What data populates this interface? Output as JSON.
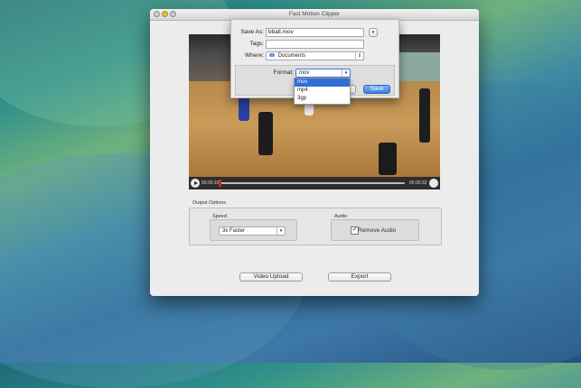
{
  "window": {
    "title": "Fast Motion Clipper"
  },
  "player": {
    "current_time": "00:00:10",
    "total_time": "00:00:32"
  },
  "output_options": {
    "group_label": "Output Options",
    "speed": {
      "label": "Speed",
      "value": "3x Faster"
    },
    "audio": {
      "label": "Audio",
      "remove_audio_label": "Remove Audio",
      "remove_audio_checked": true
    }
  },
  "buttons": {
    "video_upload": "Video Upload",
    "export": "Export"
  },
  "save_sheet": {
    "save_as_label": "Save As:",
    "save_as_value": "bball.mov",
    "tags_label": "Tags:",
    "tags_value": "",
    "where_label": "Where:",
    "where_value": "Documents",
    "format_label": "Format:",
    "format_value": "mov",
    "format_options": [
      "mov",
      "mp4",
      "3gp"
    ],
    "save_button": "Save"
  },
  "icons": {
    "expand": "chevron-down-icon",
    "folder": "folder-icon",
    "play": "play-icon",
    "volume": "volume-icon",
    "checkbox": "checkmark-icon"
  }
}
